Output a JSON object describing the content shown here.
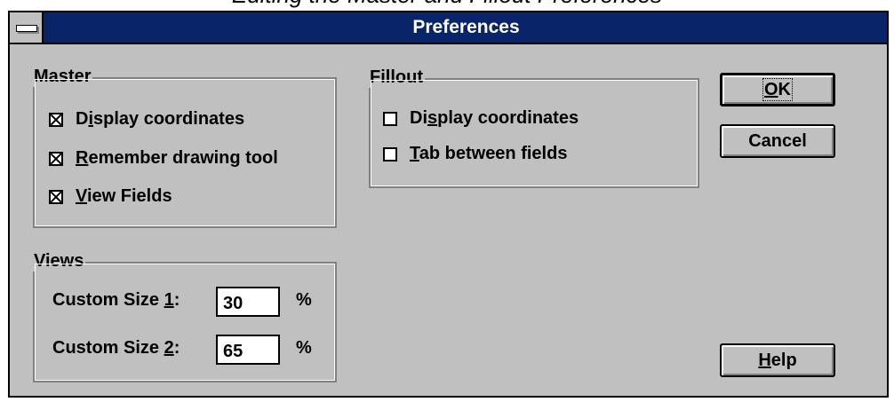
{
  "clipped_caption": "Editing the Master and Fillout Preferences",
  "window": {
    "title": "Preferences"
  },
  "master": {
    "label": "Master",
    "items": [
      {
        "pre": "D",
        "u": "i",
        "post": "splay coordinates",
        "checked": true
      },
      {
        "pre": "",
        "u": "R",
        "post": "emember drawing tool",
        "checked": true
      },
      {
        "pre": "",
        "u": "V",
        "post": "iew Fields",
        "checked": true
      }
    ]
  },
  "fillout": {
    "label": "Fillout",
    "items": [
      {
        "pre": "Di",
        "u": "s",
        "post": "play coordinates",
        "checked": false
      },
      {
        "pre": "",
        "u": "T",
        "post": "ab between fields",
        "checked": false
      }
    ]
  },
  "views": {
    "label": "Views",
    "size1": {
      "pre": "Custom Size ",
      "u": "1",
      "post": ":",
      "value": "30",
      "unit": "%"
    },
    "size2": {
      "pre": "Custom Size ",
      "u": "2",
      "post": ":",
      "value": "65",
      "unit": "%"
    }
  },
  "buttons": {
    "ok": {
      "u": "O",
      "post": "K"
    },
    "cancel": {
      "label": "Cancel"
    },
    "help": {
      "u": "H",
      "post": "elp"
    }
  }
}
